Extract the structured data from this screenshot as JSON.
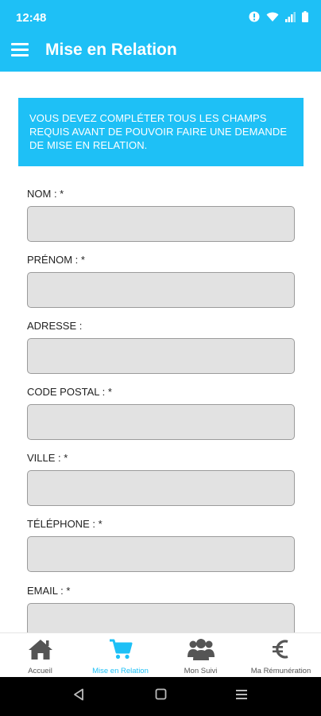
{
  "status": {
    "time": "12:48",
    "icons": [
      "info-icon",
      "wifi-icon",
      "signal-icon",
      "battery-icon"
    ]
  },
  "appbar": {
    "title": "Mise en Relation",
    "menu_icon": "hamburger-menu-icon"
  },
  "notice": {
    "text": "VOUS DEVEZ COMPLÉTER TOUS LES CHAMPS REQUIS AVANT DE POUVOIR FAIRE UNE DEMANDE DE MISE EN RELATION."
  },
  "form": {
    "fields": [
      {
        "label": "NOM : *",
        "value": ""
      },
      {
        "label": "PRÉNOM : *",
        "value": ""
      },
      {
        "label": "ADRESSE :",
        "value": ""
      },
      {
        "label": "CODE POSTAL : *",
        "value": ""
      },
      {
        "label": "VILLE : *",
        "value": ""
      },
      {
        "label": "TÉLÉPHONE : *",
        "value": ""
      },
      {
        "label": "EMAIL : *",
        "value": ""
      }
    ]
  },
  "bottomnav": {
    "items": [
      {
        "label": "Accueil",
        "icon": "home-icon",
        "active": false
      },
      {
        "label": "Mise en Relation",
        "icon": "cart-icon",
        "active": true
      },
      {
        "label": "Mon Suivi",
        "icon": "users-icon",
        "active": false
      },
      {
        "label": "Ma Rémunération",
        "icon": "euro-icon",
        "active": false
      }
    ]
  },
  "colors": {
    "accent": "#1ec0f6",
    "input_bg": "#e2e2e2",
    "inactive_nav": "#555555"
  }
}
